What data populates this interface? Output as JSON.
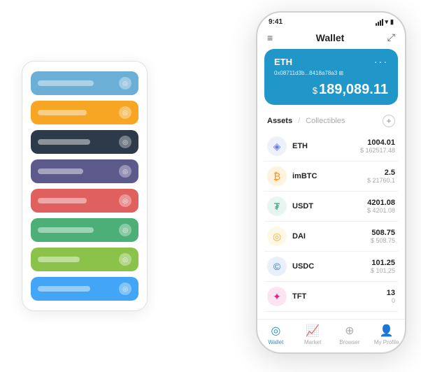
{
  "scene": {
    "cards": [
      {
        "color": "#6baed6",
        "label_width": "80px"
      },
      {
        "color": "#f6a623",
        "label_width": "70px"
      },
      {
        "color": "#2d3a4a",
        "label_width": "75px"
      },
      {
        "color": "#5c5a8a",
        "label_width": "65px"
      },
      {
        "color": "#e06060",
        "label_width": "70px"
      },
      {
        "color": "#4caf77",
        "label_width": "80px"
      },
      {
        "color": "#8bc34a",
        "label_width": "60px"
      },
      {
        "color": "#42a5f5",
        "label_width": "75px"
      }
    ]
  },
  "phone": {
    "status_bar": {
      "time": "9:41",
      "signal": "●●●",
      "wifi": "wifi",
      "battery": "battery"
    },
    "header": {
      "menu_icon": "≡",
      "title": "Wallet",
      "expand_icon": "⤢"
    },
    "eth_card": {
      "title": "ETH",
      "dots": "···",
      "address": "0x08711d3b...8418a78a3  ⊞",
      "balance_currency": "$",
      "balance": "189,089.11"
    },
    "assets_section": {
      "tab_active": "Assets",
      "divider": "/",
      "tab_inactive": "Collectibles",
      "add_icon": "+"
    },
    "assets": [
      {
        "name": "ETH",
        "icon": "◈",
        "icon_color": "#627eea",
        "icon_bg": "#eef0fc",
        "amount": "1004.01",
        "usd": "$ 162517.48"
      },
      {
        "name": "imBTC",
        "icon": "₿",
        "icon_color": "#f7931a",
        "icon_bg": "#fff3e0",
        "amount": "2.5",
        "usd": "$ 21760.1"
      },
      {
        "name": "USDT",
        "icon": "₮",
        "icon_color": "#26a17b",
        "icon_bg": "#e8f5f1",
        "amount": "4201.08",
        "usd": "$ 4201.08"
      },
      {
        "name": "DAI",
        "icon": "◎",
        "icon_color": "#f5ac37",
        "icon_bg": "#fef8e7",
        "amount": "508.75",
        "usd": "$ 508.75"
      },
      {
        "name": "USDC",
        "icon": "©",
        "icon_color": "#2775ca",
        "icon_bg": "#e8f0fc",
        "amount": "101.25",
        "usd": "$ 101.25"
      },
      {
        "name": "TFT",
        "icon": "✦",
        "icon_color": "#e91e8c",
        "icon_bg": "#fce4f3",
        "amount": "13",
        "usd": "0"
      }
    ],
    "bottom_nav": [
      {
        "label": "Wallet",
        "icon": "◎",
        "active": true
      },
      {
        "label": "Market",
        "icon": "📈",
        "active": false
      },
      {
        "label": "Browser",
        "icon": "⊕",
        "active": false
      },
      {
        "label": "My Profile",
        "icon": "👤",
        "active": false
      }
    ]
  }
}
